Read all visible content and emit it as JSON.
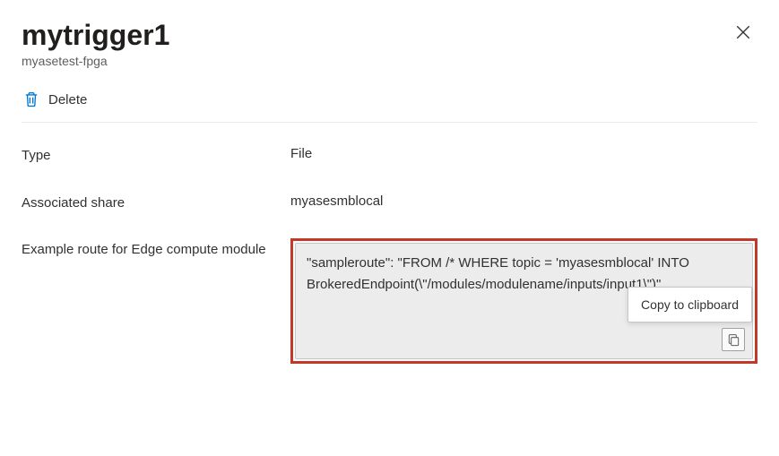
{
  "header": {
    "title": "mytrigger1",
    "subtitle": "myasetest-fpga"
  },
  "toolbar": {
    "delete_label": "Delete"
  },
  "fields": {
    "type": {
      "label": "Type",
      "value": "File"
    },
    "share": {
      "label": "Associated share",
      "value": "myasesmblocal"
    },
    "route": {
      "label": "Example route for Edge compute module",
      "value": "\"sampleroute\": \"FROM /* WHERE topic = 'myasesmblocal' INTO BrokeredEndpoint(\\\"/modules/modulename/inputs/input1\\\")\""
    }
  },
  "tooltip": "Copy to clipboard"
}
